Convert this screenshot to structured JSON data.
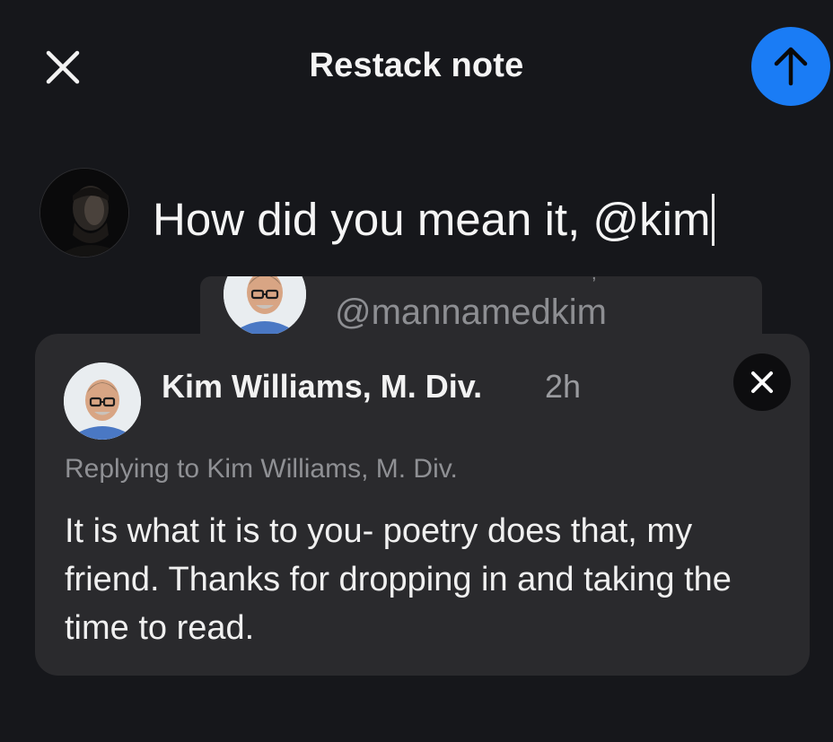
{
  "header": {
    "title": "Restack note"
  },
  "compose": {
    "text": "How did you mean it, @kim"
  },
  "mention_suggestion": {
    "name_fragment": ",",
    "handle": "@mannamedkim"
  },
  "quoted_note": {
    "author": "Kim Williams, M. Div.",
    "time": "2h",
    "replying_to": "Replying to Kim Williams, M. Div.",
    "body": "It is what it is to you- poetry does that, my friend. Thanks for dropping in and taking the time to read."
  },
  "icons": {
    "close": "close-icon",
    "send": "arrow-up-icon",
    "remove": "close-icon"
  },
  "colors": {
    "background": "#16171b",
    "accent": "#1a7cf5",
    "card": "#2a2a2d"
  }
}
